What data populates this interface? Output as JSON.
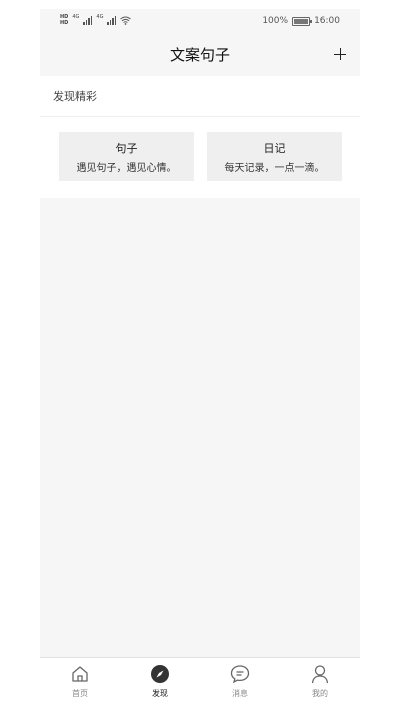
{
  "status_bar": {
    "battery_percent": "100%",
    "time": "16:00"
  },
  "header": {
    "title": "文案句子",
    "add_icon": "plus-icon"
  },
  "discover": {
    "section_title": "发现精彩",
    "cards": [
      {
        "title": "句子",
        "description": "遇见句子，遇见心情。"
      },
      {
        "title": "日记",
        "description": "每天记录，一点一滴。"
      }
    ]
  },
  "tabbar": {
    "active": "发现",
    "items": [
      {
        "label": "首页",
        "icon": "home-icon"
      },
      {
        "label": "发现",
        "icon": "compass-icon"
      },
      {
        "label": "消息",
        "icon": "message-icon"
      },
      {
        "label": "我的",
        "icon": "user-icon"
      }
    ]
  },
  "colors": {
    "background": "#f6f6f6",
    "card": "#efefef",
    "active_tab": "#222222",
    "inactive_tab": "#888888"
  }
}
